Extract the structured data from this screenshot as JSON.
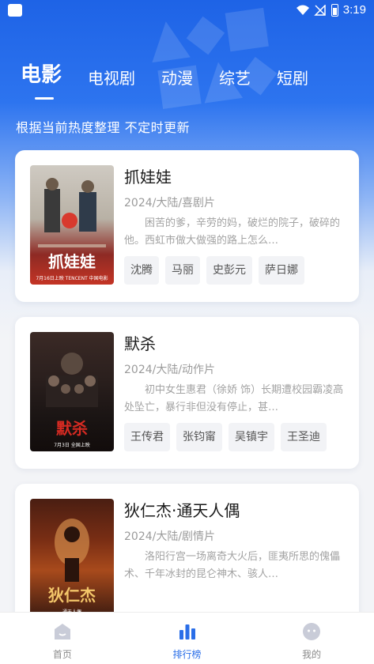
{
  "status_bar": {
    "time": "3:19"
  },
  "tabs": [
    {
      "label": "电影",
      "active": true
    },
    {
      "label": "电视剧",
      "active": false
    },
    {
      "label": "动漫",
      "active": false
    },
    {
      "label": "综艺",
      "active": false
    },
    {
      "label": "短剧",
      "active": false
    }
  ],
  "subtitle": "根据当前热度整理 不定时更新",
  "movies": [
    {
      "title": "抓娃娃",
      "meta": "2024/大陆/喜剧片",
      "desc": "困苦的爹，辛劳的妈，破烂的院子，破碎的他。西虹市做大做强的路上怎么…",
      "cast": [
        "沈腾",
        "马丽",
        "史彭元",
        "萨日娜"
      ],
      "poster_text": "抓娃娃",
      "poster_sub": "7月16日上映 TENCENT 中国电影"
    },
    {
      "title": "默杀",
      "meta": "2024/大陆/动作片",
      "desc": "初中女生惠君（徐娇 饰）长期遭校园霸凌高处坠亡，暴行非但没有停止，甚…",
      "cast": [
        "王传君",
        "张钧甯",
        "吴镇宇",
        "王圣迪"
      ],
      "poster_text": "默杀",
      "poster_sub": "7月3日 全国上映"
    },
    {
      "title": "狄仁杰·通天人偶",
      "meta": "2024/大陆/剧情片",
      "desc": "洛阳行宫一场离奇大火后，匪夷所思的傀儡术、千年冰封的昆仑神木、骇人…",
      "cast": [],
      "poster_text": "狄仁杰",
      "poster_sub": "通天人偶"
    }
  ],
  "bottom_nav": [
    {
      "label": "首页",
      "active": false
    },
    {
      "label": "排行榜",
      "active": true
    },
    {
      "label": "我的",
      "active": false
    }
  ],
  "colors": {
    "primary": "#2a6ee8",
    "hero_top": "#1e63e6",
    "background": "#f3f4f7"
  }
}
